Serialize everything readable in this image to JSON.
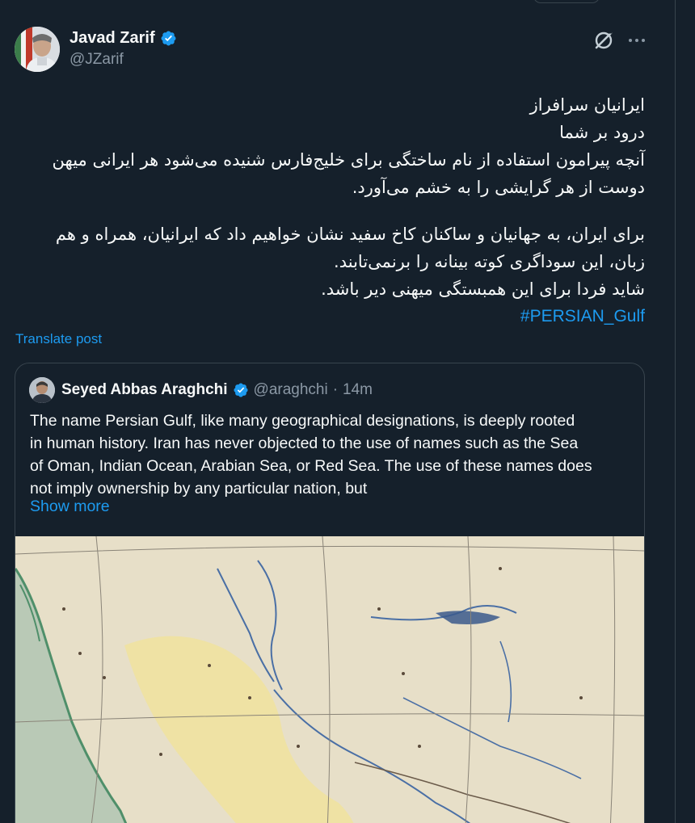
{
  "author": {
    "name": "Javad Zarif",
    "handle": "@JZarif",
    "verified_icon": "verified-badge-icon"
  },
  "header_icons": [
    "grok-icon",
    "more-icon"
  ],
  "post": {
    "lines": [
      "ایرانیان سرافراز",
      "درود بر شما",
      "آنچه پیرامون استفاده از نام ساختگی برای خلیج‌فارس شنیده می‌شود هر ایرانی میهن",
      "دوست از هر گرایشی را به خشم می‌آورد.",
      "",
      "برای ایران، به جهانیان و ساکنان کاخ سفید نشان خواهیم داد که ایرانیان، همراه و هم",
      "زبان، این سوداگری کوته بینانه را برنمی‌تابند.",
      "شاید فردا برای این همبستگی میهنی دیر باشد."
    ],
    "hashtag": "#PERSIAN_Gulf",
    "translate_label": "Translate post"
  },
  "quote": {
    "name": "Seyed Abbas Araghchi",
    "handle": "@araghchi",
    "separator": "·",
    "time": "14m",
    "lines": [
      "The name Persian Gulf, like many geographical designations, is deeply rooted",
      "in human history. Iran has never objected to the use of names such as the Sea",
      "of Oman, Indian Ocean, Arabian Sea, or Red Sea. The use of these names does",
      "not imply ownership by any particular nation, but"
    ],
    "show_more": "Show more",
    "media": "historical-map-image"
  },
  "colors": {
    "background": "#15202b",
    "text": "#f7f9f9",
    "muted": "#8b98a5",
    "accent": "#1d9bf0",
    "border": "#38444d"
  }
}
